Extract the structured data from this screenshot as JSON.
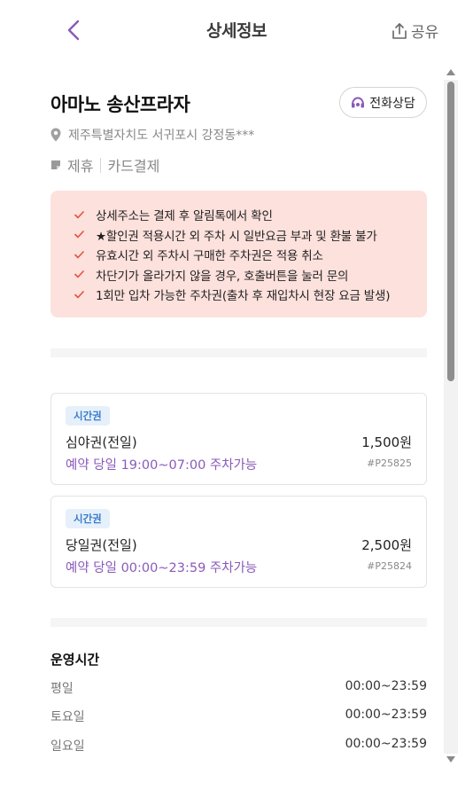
{
  "header": {
    "title": "상세정보",
    "share_label": "공유",
    "back_icon": "chevron-left-icon",
    "share_icon": "share-icon"
  },
  "place": {
    "name": "아마노 송산프라자",
    "call_label": "전화상담",
    "address": "제주특별자치도 서귀포시 강정동***",
    "tags": [
      "제휴",
      "카드결제"
    ]
  },
  "notices": [
    "상세주소는 결제 후 알림톡에서 확인",
    "★할인권 적용시간 외 주차 시 일반요금 부과 및 환불 불가",
    "유효시간 외 주차시 구매한 주차권은 적용 취소",
    "차단기가 올라가지 않을 경우, 호출버튼을 눌러 문의",
    "1회만 입차 가능한 주차권(출차 후 재입차시 현장 요금 발생)"
  ],
  "tickets": [
    {
      "badge": "시간권",
      "name": "심야권(전일)",
      "price": "1,500원",
      "availability": "예약 당일 19:00~07:00 주차가능",
      "code": "#P25825"
    },
    {
      "badge": "시간권",
      "name": "당일권(전일)",
      "price": "2,500원",
      "availability": "예약 당일 00:00~23:59 주차가능",
      "code": "#P25824"
    }
  ],
  "hours": {
    "title": "운영시간",
    "rows": [
      {
        "day": "평일",
        "time": "00:00~23:59"
      },
      {
        "day": "토요일",
        "time": "00:00~23:59"
      },
      {
        "day": "일요일",
        "time": "00:00~23:59"
      }
    ]
  },
  "colors": {
    "accent": "#8a5ab9",
    "notice_bg": "#fde1dd",
    "check": "#e0533f",
    "badge_bg": "#e6f0fb",
    "badge_text": "#3b7ccb"
  }
}
